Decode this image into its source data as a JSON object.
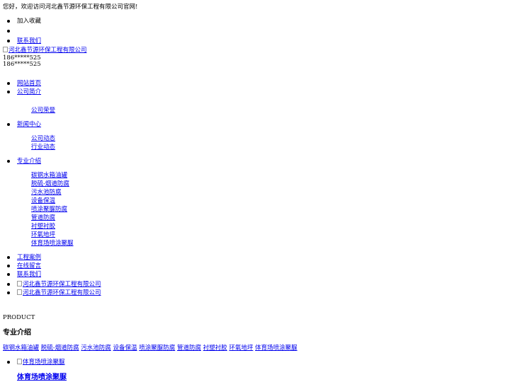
{
  "header": {
    "welcome": "您好，欢迎访问河北鑫节源环保工程有限公司官网!",
    "top_links": [
      "加入收藏",
      "",
      "联系我们"
    ],
    "logo_alt": "河北鑫节源环保工程有限公司",
    "phone_1": "186*****525",
    "phone_2": "186*****525"
  },
  "nav": {
    "home": "网站首页",
    "about": "公司简介",
    "about_sub": [
      "公司荣誉"
    ],
    "news": "新闻中心",
    "news_sub": [
      "公司动态",
      "行业动态"
    ],
    "services": "专业介绍",
    "services_sub": [
      "碳钢水箱油罐",
      "脱硫-烟道防腐",
      "污水池防腐",
      "设备保温",
      "喷涂聚脲防腐",
      "管道防腐",
      "衬塑衬胶",
      "环氧地坪",
      "体育场喷涂聚脲"
    ],
    "cases": "工程案例",
    "message": "在线留言",
    "contact": "联系我们"
  },
  "banner": {
    "slides": [
      "河北鑫节源环保工程有限公司",
      "河北鑫节源环保工程有限公司"
    ]
  },
  "product": {
    "en_label": "PRODUCT",
    "title": "专业介绍",
    "categories": [
      "碳钢水箱油罐",
      "脱硫-烟道防腐",
      "污水池防腐",
      "设备保温",
      "喷涂聚脲防腐",
      "管道防腐",
      "衬塑衬胶",
      "环氧地坪",
      "体育场喷涂聚脲"
    ],
    "first_item_img_alt": "体育场喷涂聚脲",
    "first_item_title": "体育场喷涂聚脲"
  }
}
